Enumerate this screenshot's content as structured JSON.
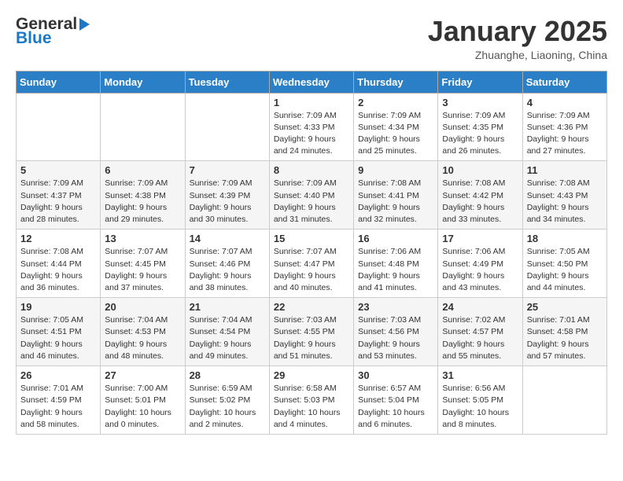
{
  "logo": {
    "general": "General",
    "blue": "Blue"
  },
  "header": {
    "month_title": "January 2025",
    "location": "Zhuanghe, Liaoning, China"
  },
  "weekdays": [
    "Sunday",
    "Monday",
    "Tuesday",
    "Wednesday",
    "Thursday",
    "Friday",
    "Saturday"
  ],
  "weeks": [
    [
      {
        "day": "",
        "info": ""
      },
      {
        "day": "",
        "info": ""
      },
      {
        "day": "",
        "info": ""
      },
      {
        "day": "1",
        "info": "Sunrise: 7:09 AM\nSunset: 4:33 PM\nDaylight: 9 hours\nand 24 minutes."
      },
      {
        "day": "2",
        "info": "Sunrise: 7:09 AM\nSunset: 4:34 PM\nDaylight: 9 hours\nand 25 minutes."
      },
      {
        "day": "3",
        "info": "Sunrise: 7:09 AM\nSunset: 4:35 PM\nDaylight: 9 hours\nand 26 minutes."
      },
      {
        "day": "4",
        "info": "Sunrise: 7:09 AM\nSunset: 4:36 PM\nDaylight: 9 hours\nand 27 minutes."
      }
    ],
    [
      {
        "day": "5",
        "info": "Sunrise: 7:09 AM\nSunset: 4:37 PM\nDaylight: 9 hours\nand 28 minutes."
      },
      {
        "day": "6",
        "info": "Sunrise: 7:09 AM\nSunset: 4:38 PM\nDaylight: 9 hours\nand 29 minutes."
      },
      {
        "day": "7",
        "info": "Sunrise: 7:09 AM\nSunset: 4:39 PM\nDaylight: 9 hours\nand 30 minutes."
      },
      {
        "day": "8",
        "info": "Sunrise: 7:09 AM\nSunset: 4:40 PM\nDaylight: 9 hours\nand 31 minutes."
      },
      {
        "day": "9",
        "info": "Sunrise: 7:08 AM\nSunset: 4:41 PM\nDaylight: 9 hours\nand 32 minutes."
      },
      {
        "day": "10",
        "info": "Sunrise: 7:08 AM\nSunset: 4:42 PM\nDaylight: 9 hours\nand 33 minutes."
      },
      {
        "day": "11",
        "info": "Sunrise: 7:08 AM\nSunset: 4:43 PM\nDaylight: 9 hours\nand 34 minutes."
      }
    ],
    [
      {
        "day": "12",
        "info": "Sunrise: 7:08 AM\nSunset: 4:44 PM\nDaylight: 9 hours\nand 36 minutes."
      },
      {
        "day": "13",
        "info": "Sunrise: 7:07 AM\nSunset: 4:45 PM\nDaylight: 9 hours\nand 37 minutes."
      },
      {
        "day": "14",
        "info": "Sunrise: 7:07 AM\nSunset: 4:46 PM\nDaylight: 9 hours\nand 38 minutes."
      },
      {
        "day": "15",
        "info": "Sunrise: 7:07 AM\nSunset: 4:47 PM\nDaylight: 9 hours\nand 40 minutes."
      },
      {
        "day": "16",
        "info": "Sunrise: 7:06 AM\nSunset: 4:48 PM\nDaylight: 9 hours\nand 41 minutes."
      },
      {
        "day": "17",
        "info": "Sunrise: 7:06 AM\nSunset: 4:49 PM\nDaylight: 9 hours\nand 43 minutes."
      },
      {
        "day": "18",
        "info": "Sunrise: 7:05 AM\nSunset: 4:50 PM\nDaylight: 9 hours\nand 44 minutes."
      }
    ],
    [
      {
        "day": "19",
        "info": "Sunrise: 7:05 AM\nSunset: 4:51 PM\nDaylight: 9 hours\nand 46 minutes."
      },
      {
        "day": "20",
        "info": "Sunrise: 7:04 AM\nSunset: 4:53 PM\nDaylight: 9 hours\nand 48 minutes."
      },
      {
        "day": "21",
        "info": "Sunrise: 7:04 AM\nSunset: 4:54 PM\nDaylight: 9 hours\nand 49 minutes."
      },
      {
        "day": "22",
        "info": "Sunrise: 7:03 AM\nSunset: 4:55 PM\nDaylight: 9 hours\nand 51 minutes."
      },
      {
        "day": "23",
        "info": "Sunrise: 7:03 AM\nSunset: 4:56 PM\nDaylight: 9 hours\nand 53 minutes."
      },
      {
        "day": "24",
        "info": "Sunrise: 7:02 AM\nSunset: 4:57 PM\nDaylight: 9 hours\nand 55 minutes."
      },
      {
        "day": "25",
        "info": "Sunrise: 7:01 AM\nSunset: 4:58 PM\nDaylight: 9 hours\nand 57 minutes."
      }
    ],
    [
      {
        "day": "26",
        "info": "Sunrise: 7:01 AM\nSunset: 4:59 PM\nDaylight: 9 hours\nand 58 minutes."
      },
      {
        "day": "27",
        "info": "Sunrise: 7:00 AM\nSunset: 5:01 PM\nDaylight: 10 hours\nand 0 minutes."
      },
      {
        "day": "28",
        "info": "Sunrise: 6:59 AM\nSunset: 5:02 PM\nDaylight: 10 hours\nand 2 minutes."
      },
      {
        "day": "29",
        "info": "Sunrise: 6:58 AM\nSunset: 5:03 PM\nDaylight: 10 hours\nand 4 minutes."
      },
      {
        "day": "30",
        "info": "Sunrise: 6:57 AM\nSunset: 5:04 PM\nDaylight: 10 hours\nand 6 minutes."
      },
      {
        "day": "31",
        "info": "Sunrise: 6:56 AM\nSunset: 5:05 PM\nDaylight: 10 hours\nand 8 minutes."
      },
      {
        "day": "",
        "info": ""
      }
    ]
  ]
}
